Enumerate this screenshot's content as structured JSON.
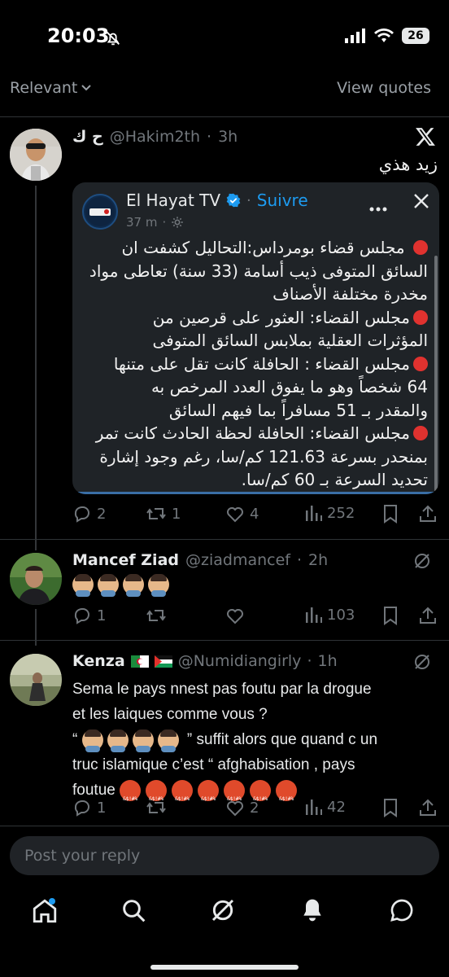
{
  "status_bar": {
    "time": "20:03",
    "battery": "26"
  },
  "top_tabs": {
    "relevant": "Relevant",
    "view_quotes": "View quotes"
  },
  "post": {
    "name": "ح ك",
    "handle": "@Hakim2th",
    "time": "3h",
    "text": "زيد هذي",
    "quote": {
      "name": "El Hayat TV",
      "follow": "Suivre",
      "time": "37 m",
      "lines": [
        "مجلس قضاء بومرداس:التحاليل كشفت ان",
        "السائق المتوفى ذيب أسامة  (33 سنة) تعاطى مواد",
        "مخدرة مختلفة الأصناف",
        "مجلس القضاء: العثور على قرصين من",
        "المؤثرات العقلية بملابس السائق المتوفى",
        "مجلس القضاء : الحافلة كانت تقل على متنها",
        "64 شخصاً وهو ما يفوق العدد المرخص به",
        "والمقدر بـ 51 مسافراً بما فيهم السائق",
        "مجلس القضاء: الحافلة لحظة الحادث كانت تمر",
        "بمنحدر بسرعة 121.63 كم/سا، رغم وجود إشارة",
        "تحديد السرعة بـ 60 كم/سا."
      ]
    },
    "stats": {
      "replies": "2",
      "reposts": "1",
      "likes": "4",
      "views": "252"
    }
  },
  "reply1": {
    "name": "Mancef Ziad",
    "handle": "@ziadmancef",
    "time": "2h",
    "stats": {
      "replies": "1",
      "reposts": "",
      "likes": "",
      "views": "103"
    }
  },
  "reply2": {
    "name": "Kenza",
    "handle": "@Numidiangirly",
    "time": "1h",
    "line1": "Sema le pays nnest pas foutu par la drogue",
    "line2": "et les laiques comme vous ?",
    "line3_open": "“",
    "line3_close": "” suffit alors que quand c un",
    "line4": "truc islamique c’est “ afghabisation , pays",
    "line5": "foutue",
    "stats": {
      "replies": "1",
      "reposts": "",
      "likes": "2",
      "views": "42"
    }
  },
  "reply_box": {
    "placeholder": "Post your reply"
  },
  "colors": {
    "background": "#000000",
    "accent": "#1d9bf0",
    "muted": "#71767b",
    "red_dot": "#e0322f"
  },
  "icons": [
    "bell-slash-icon",
    "signal-icon",
    "wifi-icon",
    "x-logo-icon",
    "verified-badge-icon",
    "more-icon",
    "close-icon",
    "reply-icon",
    "repost-icon",
    "like-icon",
    "views-icon",
    "bookmark-icon",
    "share-icon",
    "grok-icon",
    "home-icon",
    "search-icon",
    "notifications-icon",
    "messages-icon"
  ]
}
